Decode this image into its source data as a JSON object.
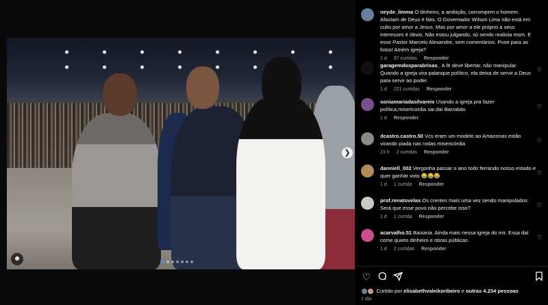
{
  "post": {
    "slide_count": 7,
    "active_slide": 1,
    "next_icon": "chevron-right-icon",
    "user_tag_icon": "user-tag-icon"
  },
  "comments": [
    {
      "user": "neyde_limma",
      "text": "O dinheiro, a ambição, corrompem o homem. Afastam de Deus é fato. O Governador Wilson Lima não está em culto por amor a Jesus. Mas por amor a ele próprio a seus interesses é óbvio. Não estou julgando, só sendo realista msm. E esse Pastor Marcelo Alexandre, sem comentários. Pose para as fotos! Amém igreja?",
      "time": "1 d",
      "likes": "97 curtidas",
      "reply": "Responder",
      "avatar_color": "#6a7f99"
    },
    {
      "user": "garagemdosparabrisas_",
      "text": "A fé deve libertar, não manipular. Quando a igreja vira palanque político, ela deixa de servir a Deus para servir ao poder.",
      "time": "1 d",
      "likes": "221 curtidas",
      "reply": "Responder",
      "avatar_color": "#111111"
    },
    {
      "user": "soniamariadasilvareis",
      "text": "Usando a igreja pra fazer política,misericordia sai daí Barrabás",
      "time": "1 d",
      "likes": "",
      "reply": "Responder",
      "avatar_color": "#7a4f8c"
    },
    {
      "user": "dcastro.castro.50",
      "text": "Vcs eram um modelo ao Amazonas estão virando piada nas rodas misericórdia",
      "time": "23 h",
      "likes": "2 curtidas",
      "reply": "Responder",
      "avatar_color": "#8a8a8a"
    },
    {
      "user": "danniell_002",
      "text": "Vergonha passar o ano todo ferrando nosso estado e quer ganhar voto 😂😂😂",
      "time": "1 d",
      "likes": "1 curtida",
      "reply": "Responder",
      "avatar_color": "#b48a5a"
    },
    {
      "user": "prof.renatovelas",
      "text": "Os crentes mais uma vez sendo manipulados. Será que esse povo não percebe isso?",
      "time": "1 d",
      "likes": "1 curtida",
      "reply": "Responder",
      "avatar_color": "#c9c9c9"
    },
    {
      "user": "acarvalho.51",
      "text": "Baixaria. Ainda mais nessa igreja do mir. Essa daí come quieto dinheiro e obras públicas.",
      "time": "1 d",
      "likes": "2 curtidas",
      "reply": "Responder",
      "avatar_color": "#c84f8f"
    }
  ],
  "actions": {
    "like_icon": "heart-icon",
    "comment_icon": "comment-icon",
    "share_icon": "share-icon",
    "save_icon": "bookmark-icon"
  },
  "likes_line": {
    "prefix": "Curtido por",
    "user": "elisabethvaleikoribeiro",
    "connector": "e",
    "others": "outras 4.234 pessoas"
  },
  "date": "1 dia",
  "colors": {
    "background": "#000000",
    "text": "#f5f5f5",
    "muted": "#a8a8a8",
    "accent": "#3b8ff6"
  }
}
